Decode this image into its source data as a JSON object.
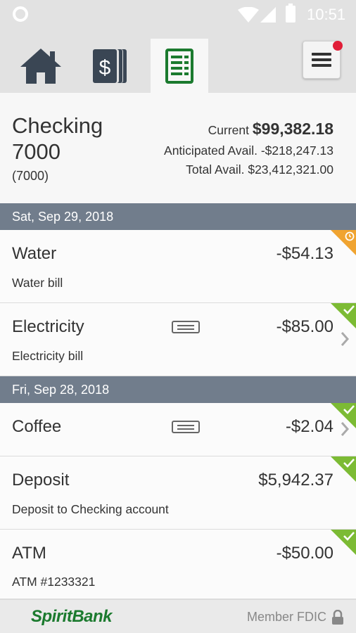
{
  "status_bar": {
    "time": "10:51"
  },
  "nav": {
    "tabs": [
      {
        "icon": "home-icon"
      },
      {
        "icon": "dollar-cards-icon"
      },
      {
        "icon": "register-list-icon",
        "active": true
      }
    ],
    "menu_icon": "hamburger-menu-icon",
    "notification_color": "#e11d37"
  },
  "account": {
    "name": "Checking 7000",
    "number": "(7000)",
    "current_label": "Current",
    "current_value": "$99,382.18",
    "anticipated": "Anticipated Avail. -$218,247.13",
    "total": "Total Avail. $23,412,321.00"
  },
  "groups": [
    {
      "date": "Sat, Sep 29, 2018",
      "transactions": [
        {
          "title": "Water",
          "description": "Water bill",
          "amount": "-$54.13",
          "status": "pending"
        },
        {
          "title": "Electricity",
          "description": "Electricity bill",
          "amount": "-$85.00",
          "status": "cleared",
          "has_receipt": true,
          "has_chevron": true
        }
      ]
    },
    {
      "date": "Fri, Sep 28, 2018",
      "transactions": [
        {
          "title": "Coffee",
          "description": "",
          "amount": "-$2.04",
          "status": "cleared",
          "has_receipt": true,
          "has_chevron": true
        },
        {
          "title": "Deposit",
          "description": "Deposit to Checking account",
          "amount": "$5,942.37",
          "status": "cleared"
        },
        {
          "title": "ATM",
          "description": "ATM #1233321",
          "amount": "-$50.00",
          "status": "cleared"
        }
      ]
    }
  ],
  "footer": {
    "logo": "SpiritBank",
    "fdic": "Member FDIC"
  },
  "colors": {
    "accent_green": "#1b7a2e",
    "cleared": "#7cbb34",
    "pending": "#f0a431",
    "date_header": "#717d8c"
  }
}
